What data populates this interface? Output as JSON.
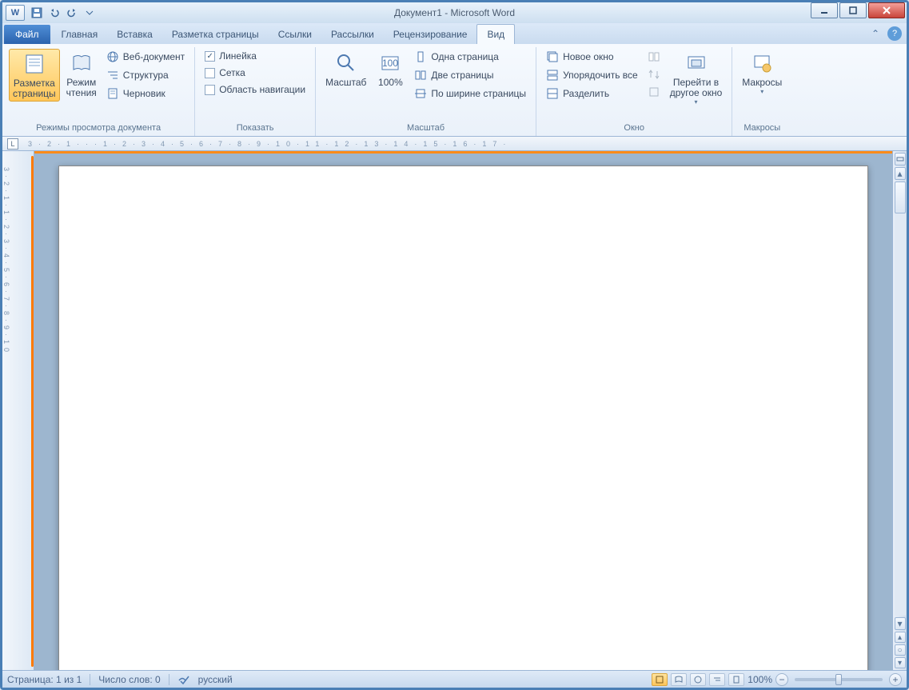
{
  "title": "Документ1 - Microsoft Word",
  "qat": {
    "word": "W"
  },
  "tabs": {
    "file": "Файл",
    "items": [
      "Главная",
      "Вставка",
      "Разметка страницы",
      "Ссылки",
      "Рассылки",
      "Рецензирование",
      "Вид"
    ],
    "active": "Вид"
  },
  "ribbon": {
    "views": {
      "label": "Режимы просмотра документа",
      "print_layout": "Разметка\nстраницы",
      "reading": "Режим\nчтения",
      "web": "Веб-документ",
      "outline": "Структура",
      "draft": "Черновик"
    },
    "show": {
      "label": "Показать",
      "ruler": "Линейка",
      "ruler_checked": true,
      "grid": "Сетка",
      "grid_checked": false,
      "navpane": "Область навигации",
      "navpane_checked": false
    },
    "zoom": {
      "label": "Масштаб",
      "zoom": "Масштаб",
      "hundred": "100%",
      "one_page": "Одна страница",
      "two_pages": "Две страницы",
      "page_width": "По ширине страницы"
    },
    "window": {
      "label": "Окно",
      "new_window": "Новое окно",
      "arrange_all": "Упорядочить все",
      "split": "Разделить",
      "switch": "Перейти в\nдругое окно"
    },
    "macros": {
      "label": "Макросы",
      "macros": "Макросы"
    }
  },
  "ruler_tabstop": "L",
  "statusbar": {
    "page": "Страница: 1 из 1",
    "words": "Число слов: 0",
    "language": "русский",
    "zoom": "100%"
  }
}
